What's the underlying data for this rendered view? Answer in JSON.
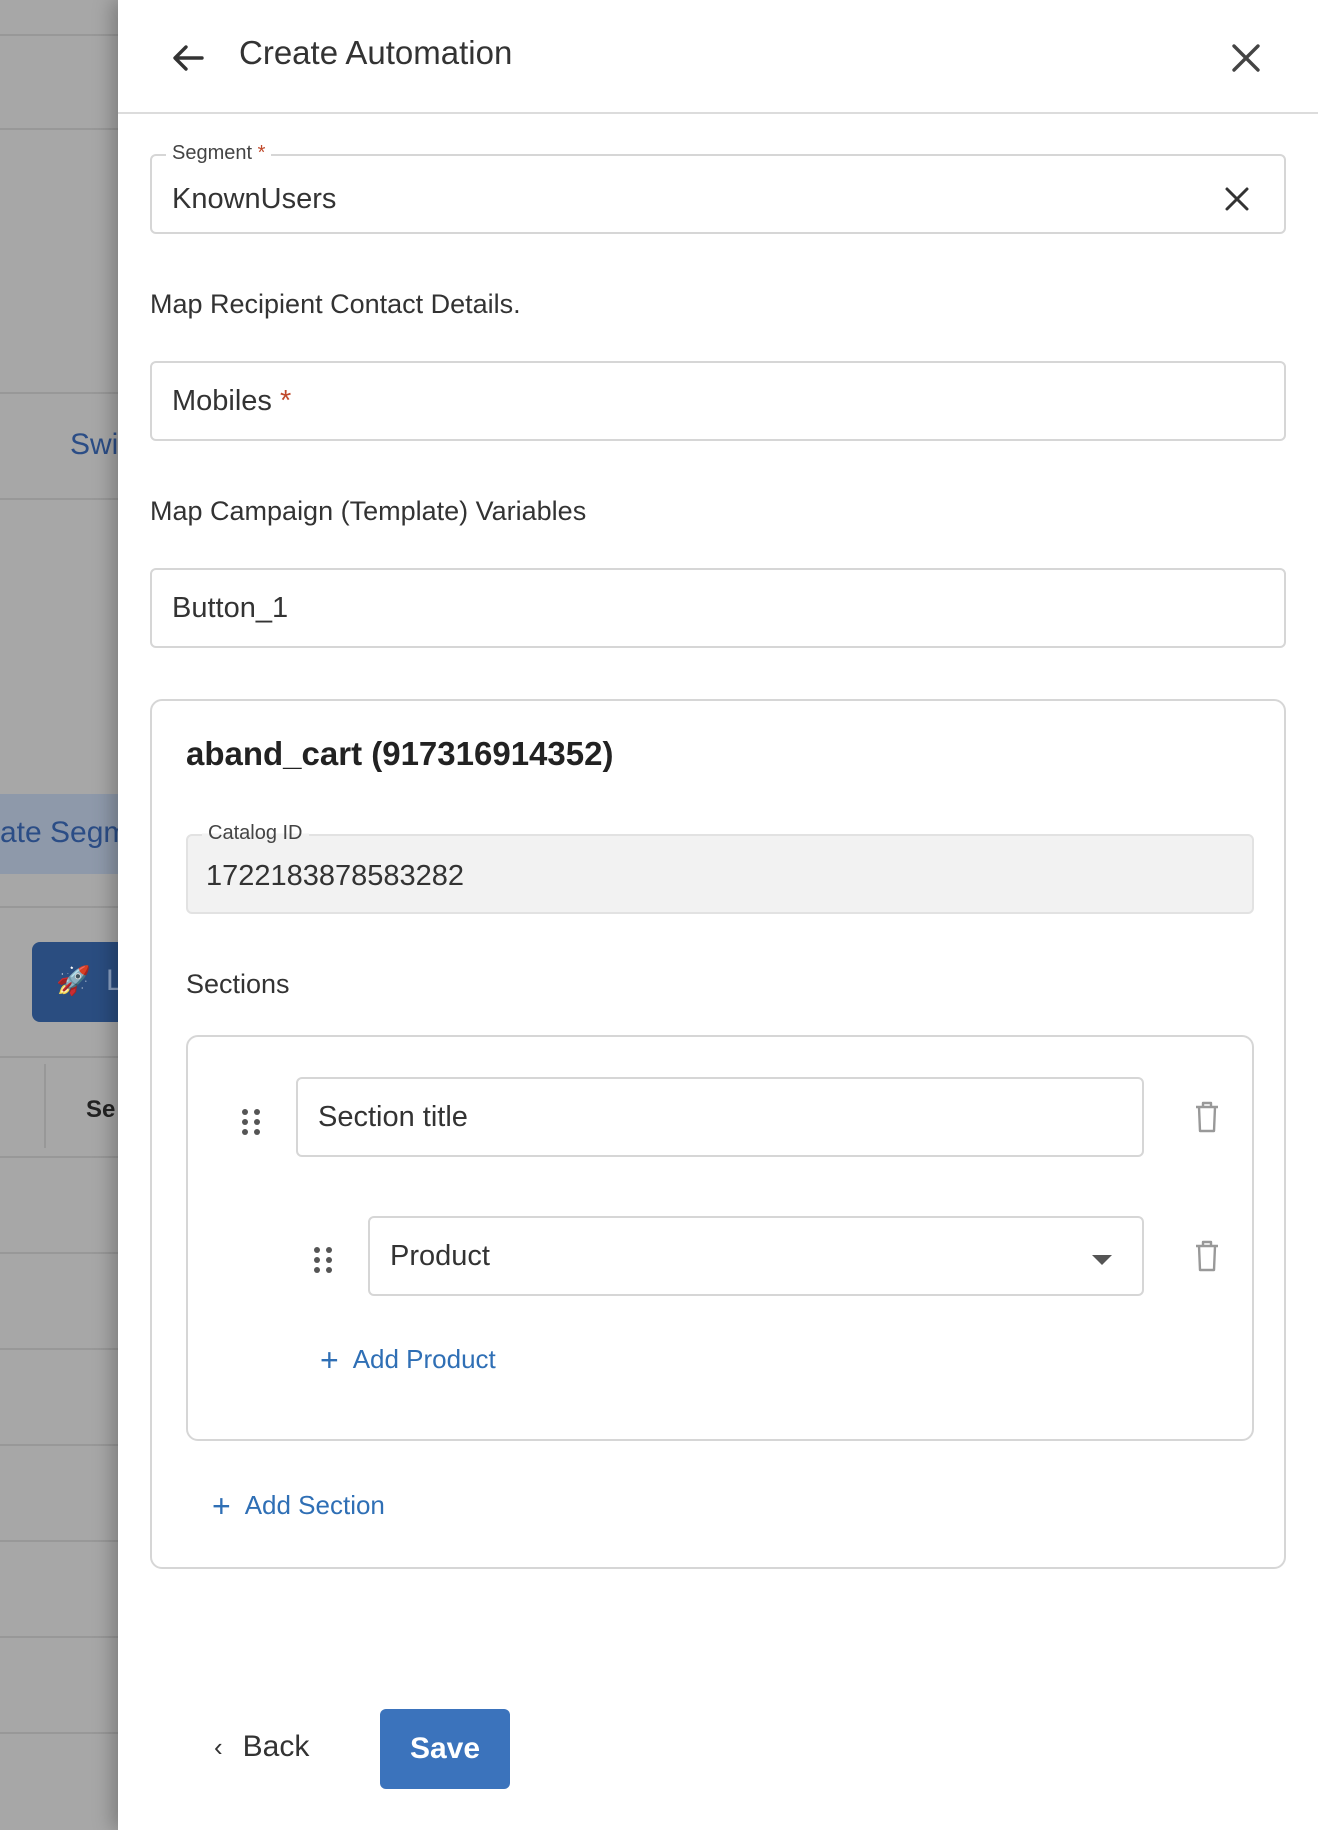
{
  "background": {
    "switch_text": "Swi",
    "segment_btn_text": "ate Segm",
    "launch_text": "L",
    "column_text": "Se"
  },
  "drawer": {
    "title": "Create Automation",
    "segment": {
      "label": "Segment",
      "required_mark": "*",
      "value": "KnownUsers"
    },
    "recipient_heading": "Map Recipient Contact Details.",
    "mobiles": {
      "label": "Mobiles",
      "required_mark": "*"
    },
    "variables_heading": "Map Campaign (Template) Variables",
    "button_field": {
      "value": "Button_1"
    },
    "template_card": {
      "title": "aband_cart (917316914352)",
      "catalog": {
        "label": "Catalog ID",
        "value": "1722183878583282"
      },
      "sections_heading": "Sections",
      "section_title_placeholder": "Section title",
      "product_select_value": "Product",
      "add_product_label": "Add Product",
      "add_section_label": "Add Section"
    },
    "footer": {
      "back_label": "Back",
      "save_label": "Save"
    }
  },
  "icons": {
    "back": "arrow-left-icon",
    "close": "close-icon",
    "clear": "clear-icon",
    "drag": "drag-handle-icon",
    "delete": "trash-icon",
    "plus": "plus-icon",
    "dropdown": "caret-down-icon",
    "chevron": "chevron-left-icon",
    "rocket": "rocket-icon"
  },
  "colors": {
    "primary": "#3b73bc",
    "link": "#2f6fb5",
    "required": "#c0492b",
    "overlay": "#a7a7a7"
  }
}
